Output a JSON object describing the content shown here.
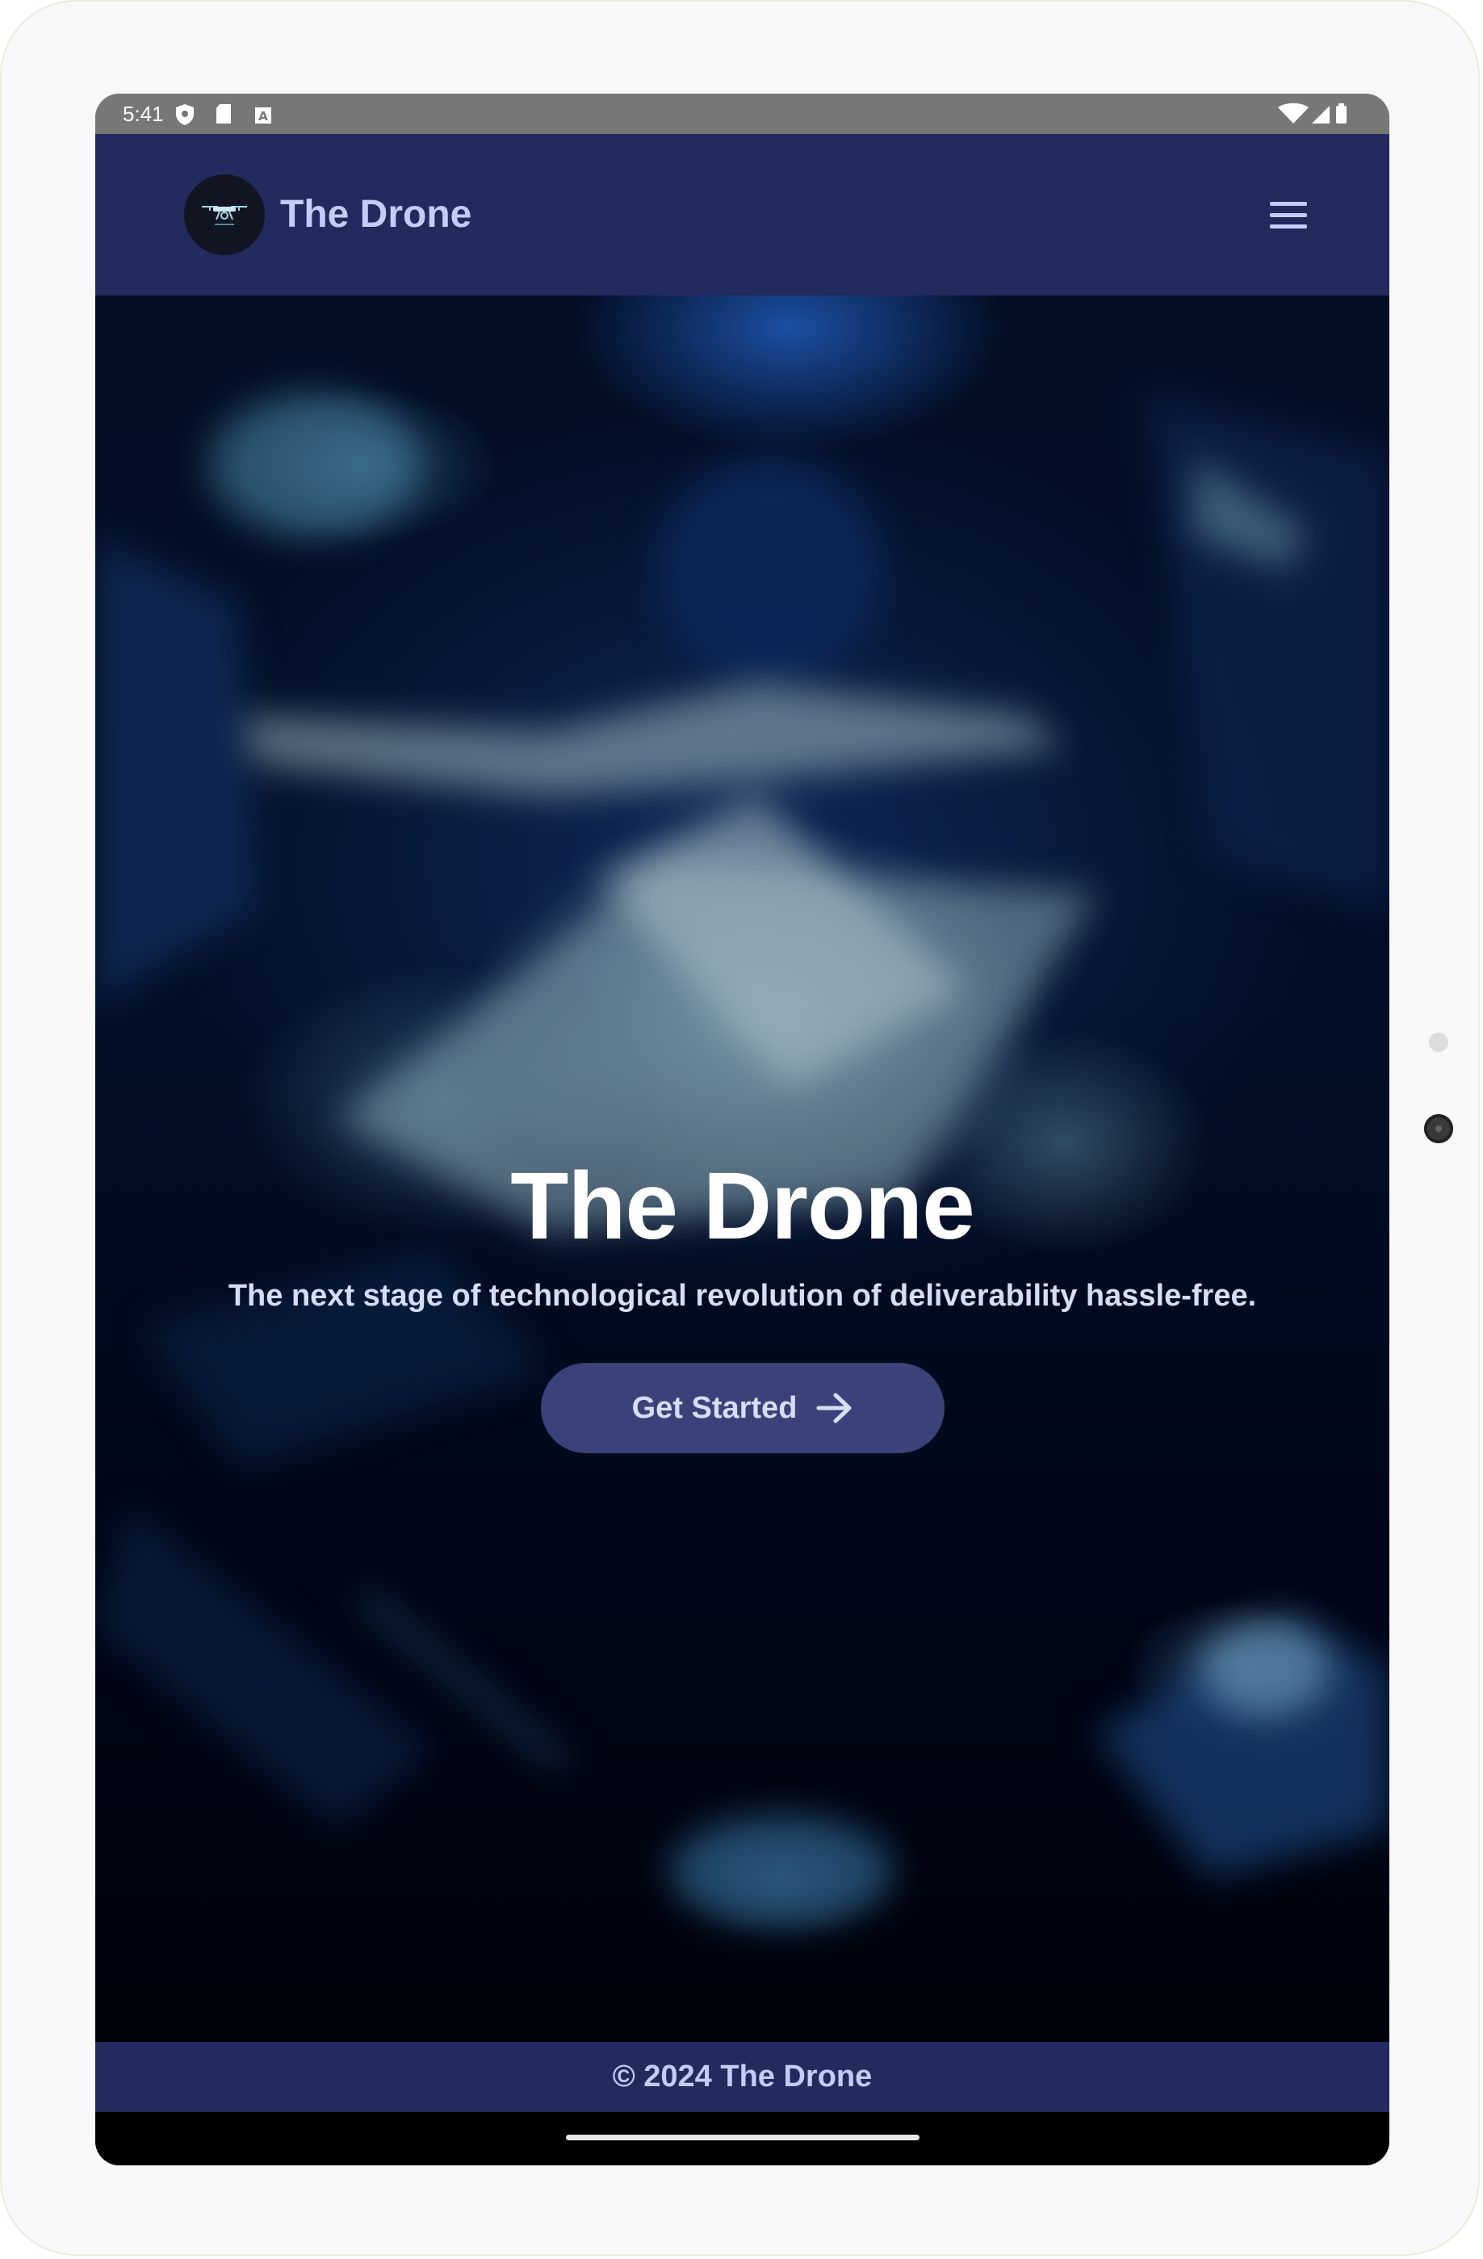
{
  "status_bar": {
    "time": "5:41",
    "left_icons": [
      "shield-icon",
      "sd-card-icon",
      "text-a-icon"
    ],
    "right_icons": [
      "wifi-icon",
      "cell-signal-icon",
      "battery-icon"
    ]
  },
  "app_bar": {
    "brand": "The Drone",
    "logo_icon": "drone-icon",
    "menu_icon": "hamburger-menu-icon"
  },
  "hero": {
    "title": "The Drone",
    "subtitle": "The next stage of technological revolution of deliverability hassle-free.",
    "cta_label": "Get Started",
    "cta_icon": "arrow-right-icon"
  },
  "footer": {
    "text": "© 2024 The Drone"
  },
  "colors": {
    "app_bar_bg": "#222a5e",
    "brand_text": "#c3cdf7",
    "cta_bg": "#3a4279",
    "status_bar_bg": "#777777"
  }
}
